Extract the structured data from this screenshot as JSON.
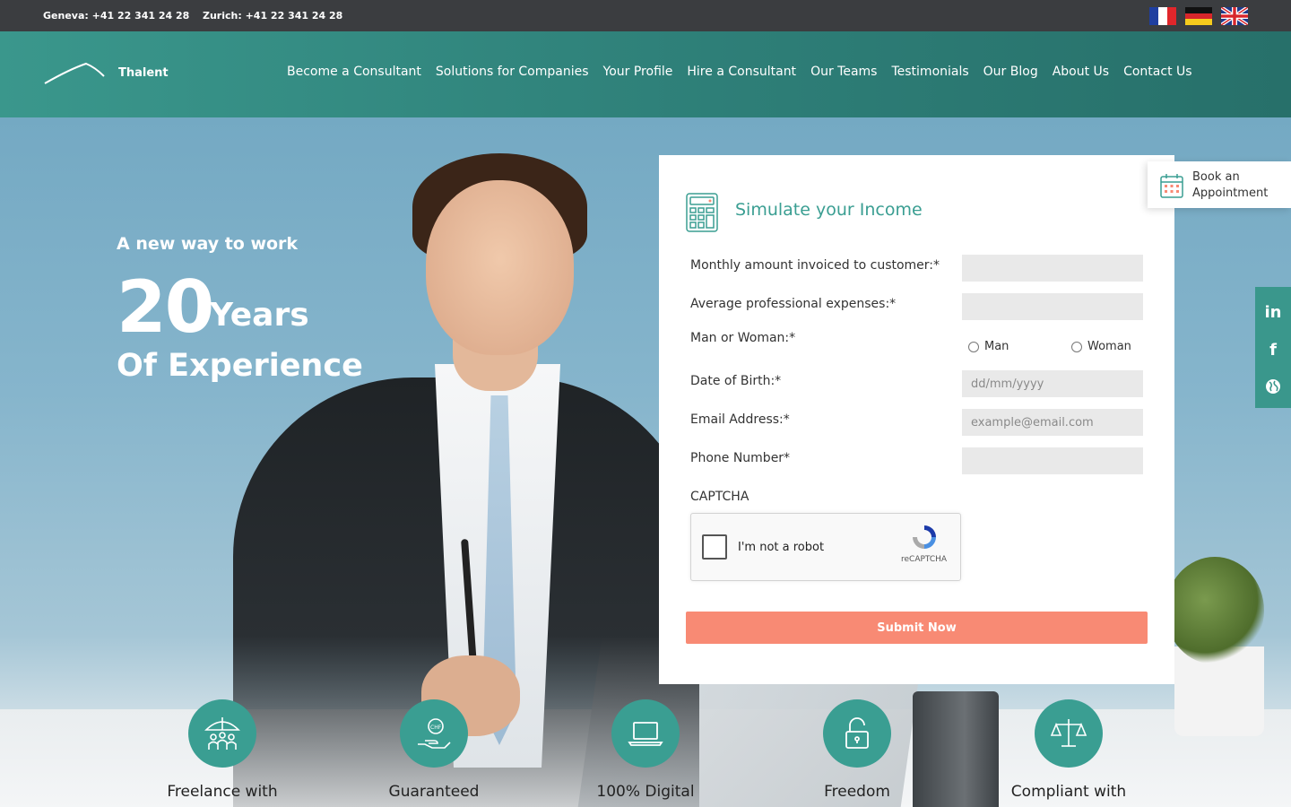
{
  "topbar": {
    "phones": [
      "Geneva: +41 22 341 24 28",
      "Zurich: +41 22 341 24 28"
    ],
    "flags": [
      "france-flag-icon",
      "germany-flag-icon",
      "uk-flag-icon"
    ]
  },
  "header": {
    "brand": "Thalent",
    "nav": [
      "Become a Consultant",
      "Solutions for Companies",
      "Your Profile",
      "Hire a Consultant",
      "Our Teams",
      "Testimonials",
      "Our Blog",
      "About Us",
      "Contact Us"
    ]
  },
  "hero": {
    "tagline": "A new way to work",
    "number": "20",
    "unit": "Years",
    "line2": "Of Experience"
  },
  "form": {
    "title": "Simulate your Income",
    "monthly_label": "Monthly amount invoiced to customer:*",
    "expenses_label": "Average professional expenses:*",
    "gender_label": "Man or Woman:*",
    "gender_options": [
      "Man",
      "Woman"
    ],
    "dob_label": "Date of Birth:*",
    "dob_placeholder": "dd/mm/yyyy",
    "email_label": "Email Address:*",
    "email_placeholder": "example@email.com",
    "phone_label": "Phone Number*",
    "captcha_label": "CAPTCHA",
    "recaptcha_text": "I'm not a robot",
    "recaptcha_brand": "reCAPTCHA",
    "submit": "Submit Now"
  },
  "book": {
    "label": "Book an Appointment"
  },
  "social": [
    "in",
    "f",
    "globe-icon"
  ],
  "features": [
    "Freelance with",
    "Guaranteed",
    "100% Digital",
    "Freedom",
    "Compliant with"
  ],
  "colors": {
    "teal": "#3a978c",
    "submit": "#f88a74",
    "topbar": "#3b3d40"
  }
}
